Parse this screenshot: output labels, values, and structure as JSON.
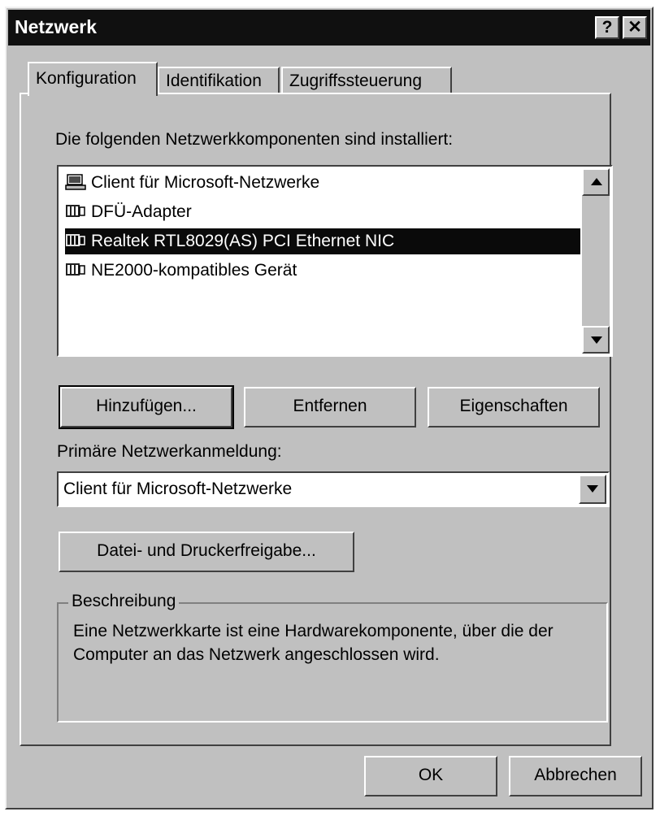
{
  "window": {
    "title": "Netzwerk",
    "help_label": "?",
    "close_label": "✕"
  },
  "tabs": [
    {
      "label": "Konfiguration",
      "active": true
    },
    {
      "label": "Identifikation",
      "active": false
    },
    {
      "label": "Zugriffssteuerung",
      "active": false
    }
  ],
  "components": {
    "heading": "Die folgenden Netzwerkkomponenten sind installiert:",
    "items": [
      {
        "label": "Client für Microsoft-Netzwerke",
        "icon": "computer-client-icon",
        "selected": false
      },
      {
        "label": "DFÜ-Adapter",
        "icon": "network-adapter-icon",
        "selected": false
      },
      {
        "label": "Realtek RTL8029(AS) PCI Ethernet NIC",
        "icon": "network-adapter-icon",
        "selected": true
      },
      {
        "label": "NE2000-kompatibles Gerät",
        "icon": "network-adapter-icon",
        "selected": false
      }
    ]
  },
  "buttons": {
    "add": "Hinzufügen...",
    "remove": "Entfernen",
    "properties": "Eigenschaften",
    "file_print_sharing": "Datei- und Druckerfreigabe...",
    "ok": "OK",
    "cancel": "Abbrechen"
  },
  "primary_logon": {
    "label": "Primäre Netzwerkanmeldung:",
    "value": "Client für Microsoft-Netzwerke"
  },
  "description": {
    "caption": "Beschreibung",
    "text": "Eine Netzwerkkarte ist eine Hardwarekomponente, über die der Computer an das Netzwerk angeschlossen wird."
  }
}
